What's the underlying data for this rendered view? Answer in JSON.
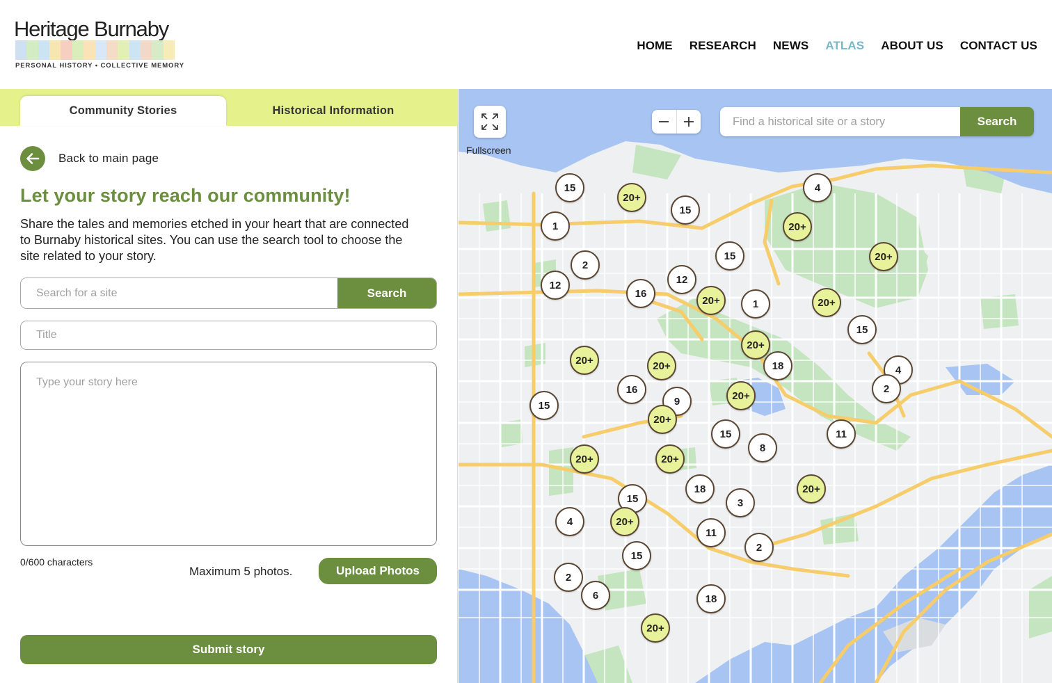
{
  "brand": {
    "title": "Heritage Burnaby",
    "tagline": "PERSONAL HISTORY • COLLECTIVE MEMORY"
  },
  "nav": {
    "items": [
      {
        "label": "HOME",
        "key": "home"
      },
      {
        "label": "RESEARCH",
        "key": "research"
      },
      {
        "label": "NEWS",
        "key": "news"
      },
      {
        "label": "ATLAS",
        "key": "atlas",
        "active": true
      },
      {
        "label": "ABOUT US",
        "key": "about"
      },
      {
        "label": "CONTACT US",
        "key": "contact"
      }
    ],
    "active_color": "#79b6c8"
  },
  "tabs": {
    "community": "Community Stories",
    "historical": "Historical Information"
  },
  "back": {
    "label": "Back to main page",
    "icon": "arrow-left-icon"
  },
  "form": {
    "heading": "Let your story reach our community!",
    "description": "Share the tales and memories etched in your heart that are connected to Burnaby historical sites. You can use the search tool to choose the site related to your story.",
    "site_search_placeholder": "Search for a site",
    "site_search_button": "Search",
    "title_placeholder": "Title",
    "story_placeholder": "Type your story here",
    "char_count": "0/600 characters",
    "max_photos": "Maximum 5 photos.",
    "upload_button": "Upload Photos",
    "submit_button": "Submit story"
  },
  "map": {
    "fullscreen_label": "Fullscreen",
    "search_placeholder": "Find a historical site or a story",
    "search_button": "Search",
    "markers": [
      "15",
      "20+",
      "15",
      "4",
      "1",
      "20+",
      "20+",
      "15",
      "2",
      "12",
      "12",
      "16",
      "20+",
      "1",
      "20+",
      "15",
      "20+",
      "18",
      "4",
      "20+",
      "20+",
      "2",
      "16",
      "9",
      "20+",
      "15",
      "20+",
      "15",
      "8",
      "11",
      "20+",
      "20+",
      "18",
      "3",
      "20+",
      "15",
      "4",
      "20+",
      "11",
      "2",
      "15",
      "2",
      "6",
      "18",
      "20+"
    ]
  },
  "colors": {
    "brand_green": "#6b8f3f",
    "tab_bar": "#e5f28c",
    "cluster_big": "#e8f29a",
    "water": "#a7c4f2",
    "park": "#c5e4c0",
    "road": "#f6cd6a"
  }
}
